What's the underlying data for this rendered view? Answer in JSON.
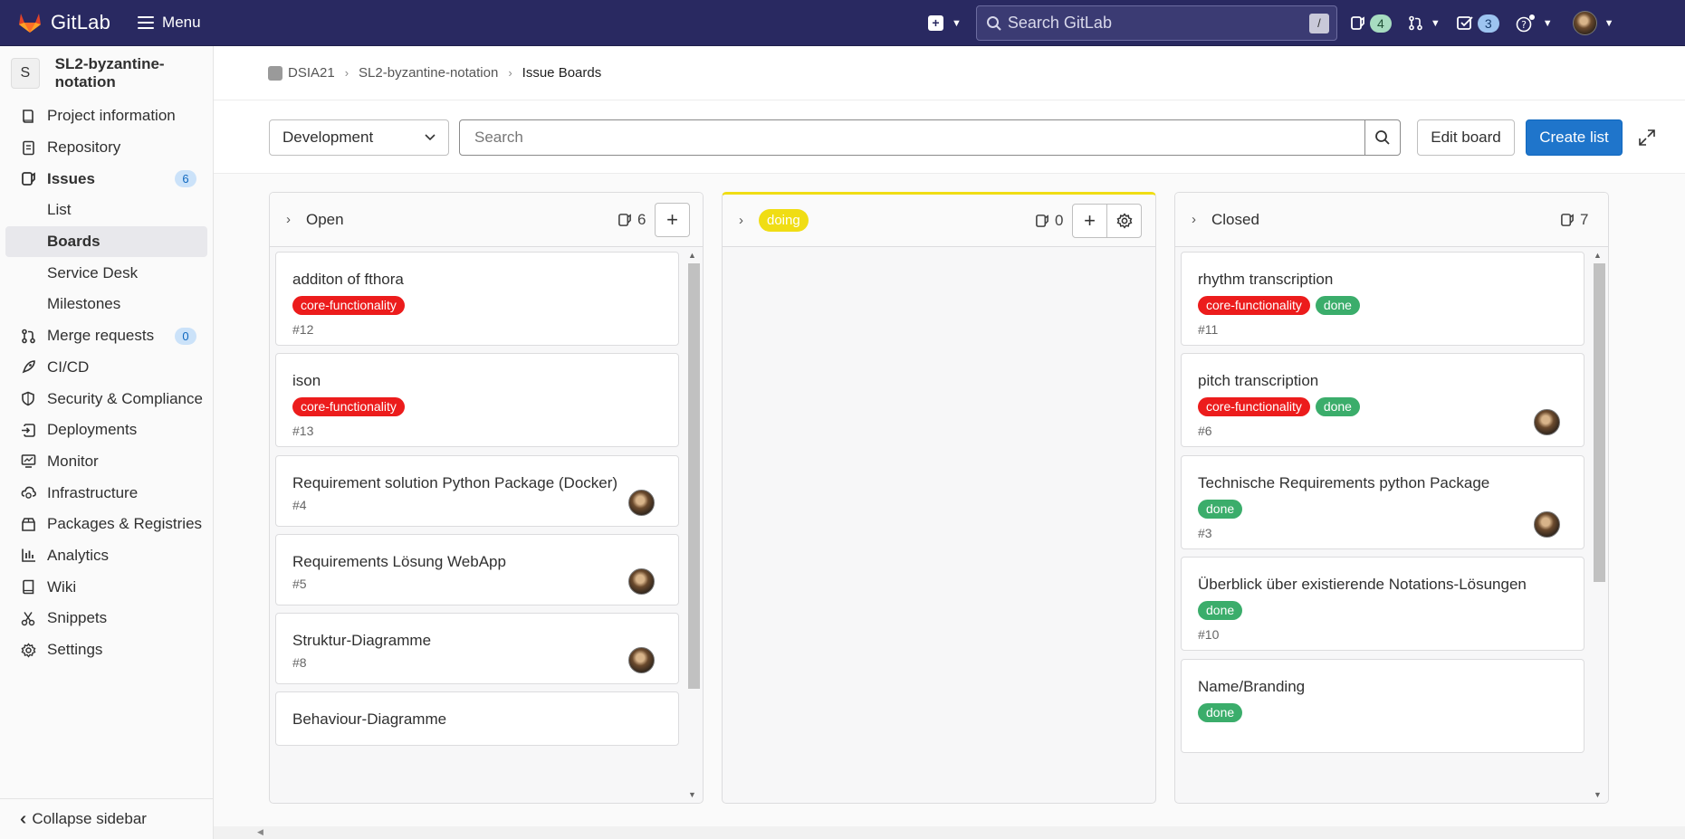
{
  "topbar": {
    "app_name": "GitLab",
    "menu_label": "Menu",
    "search_placeholder": "Search GitLab",
    "search_shortcut": "/",
    "issues_count": "4",
    "todos_count": "3"
  },
  "sidebar": {
    "project_initial": "S",
    "project_name": "SL2-byzantine-notation",
    "items": [
      {
        "label": "Project information"
      },
      {
        "label": "Repository"
      },
      {
        "label": "Issues",
        "badge": "6"
      },
      {
        "label": "List"
      },
      {
        "label": "Boards"
      },
      {
        "label": "Service Desk"
      },
      {
        "label": "Milestones"
      },
      {
        "label": "Merge requests",
        "badge": "0"
      },
      {
        "label": "CI/CD"
      },
      {
        "label": "Security & Compliance"
      },
      {
        "label": "Deployments"
      },
      {
        "label": "Monitor"
      },
      {
        "label": "Infrastructure"
      },
      {
        "label": "Packages & Registries"
      },
      {
        "label": "Analytics"
      },
      {
        "label": "Wiki"
      },
      {
        "label": "Snippets"
      },
      {
        "label": "Settings"
      }
    ],
    "collapse_label": "Collapse sidebar"
  },
  "breadcrumb": {
    "group": "DSIA21",
    "project": "SL2-byzantine-notation",
    "current": "Issue Boards"
  },
  "toolbar": {
    "board_select": "Development",
    "search_placeholder": "Search",
    "edit_board": "Edit board",
    "create_list": "Create list"
  },
  "colors": {
    "topbar": "#292961",
    "primary": "#1f75cb",
    "label_core": "#ec1c1c",
    "label_done": "#3bad6b",
    "label_doing": "#f0dd14"
  },
  "lists": {
    "open": {
      "title": "Open",
      "count": "6",
      "cards": [
        {
          "title": "additon of fthora",
          "labels": [
            "core-functionality"
          ],
          "id": "#12"
        },
        {
          "title": "ison",
          "labels": [
            "core-functionality"
          ],
          "id": "#13"
        },
        {
          "title": "Requirement solution Python Package (Docker)",
          "id": "#4"
        },
        {
          "title": "Requirements Lösung WebApp",
          "id": "#5"
        },
        {
          "title": "Struktur-Diagramme",
          "id": "#8"
        },
        {
          "title": "Behaviour-Diagramme"
        }
      ]
    },
    "doing": {
      "title": "doing",
      "count": "0"
    },
    "closed": {
      "title": "Closed",
      "count": "7",
      "cards": [
        {
          "title": "rhythm transcription",
          "labels": [
            "core-functionality",
            "done"
          ],
          "id": "#11"
        },
        {
          "title": "pitch transcription",
          "labels": [
            "core-functionality",
            "done"
          ],
          "id": "#6"
        },
        {
          "title": "Technische Requirements python Package",
          "labels": [
            "done"
          ],
          "id": "#3"
        },
        {
          "title": "Überblick über existierende Notations-Lösungen",
          "labels": [
            "done"
          ],
          "id": "#10"
        },
        {
          "title": "Name/Branding",
          "labels": [
            "done"
          ]
        }
      ]
    }
  }
}
